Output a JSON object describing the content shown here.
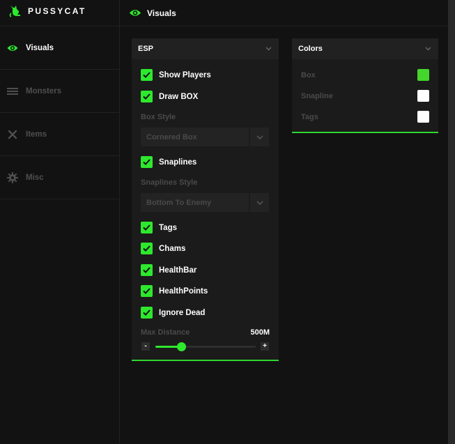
{
  "app": {
    "name": "PUSSYCAT",
    "accent": "#2ee82e"
  },
  "sidebar": {
    "items": [
      {
        "label": "Visuals",
        "icon": "eye-icon",
        "active": true
      },
      {
        "label": "Monsters",
        "icon": "menu-icon",
        "active": false
      },
      {
        "label": "Items",
        "icon": "x-icon",
        "active": false
      },
      {
        "label": "Misc",
        "icon": "gear-icon",
        "active": false
      }
    ]
  },
  "header": {
    "title": "Visuals"
  },
  "esp": {
    "title": "ESP",
    "show_players": "Show Players",
    "draw_box": "Draw BOX",
    "box_style_label": "Box Style",
    "box_style_value": "Cornered Box",
    "snaplines": "Snaplines",
    "snaplines_style_label": "Snaplines Style",
    "snaplines_style_value": "Bottom To Enemy",
    "tags": "Tags",
    "chams": "Chams",
    "healthbar": "HealthBar",
    "healthpoints": "HealthPoints",
    "ignore_dead": "Ignore Dead",
    "max_distance_label": "Max Distance",
    "max_distance_value": "500M",
    "max_distance_fraction": 0.26,
    "minus": "-",
    "plus": "+"
  },
  "colors": {
    "title": "Colors",
    "items": [
      {
        "label": "Box",
        "color": "#44d62c"
      },
      {
        "label": "Snapline",
        "color": "#ffffff"
      },
      {
        "label": "Tags",
        "color": "#ffffff"
      }
    ]
  }
}
